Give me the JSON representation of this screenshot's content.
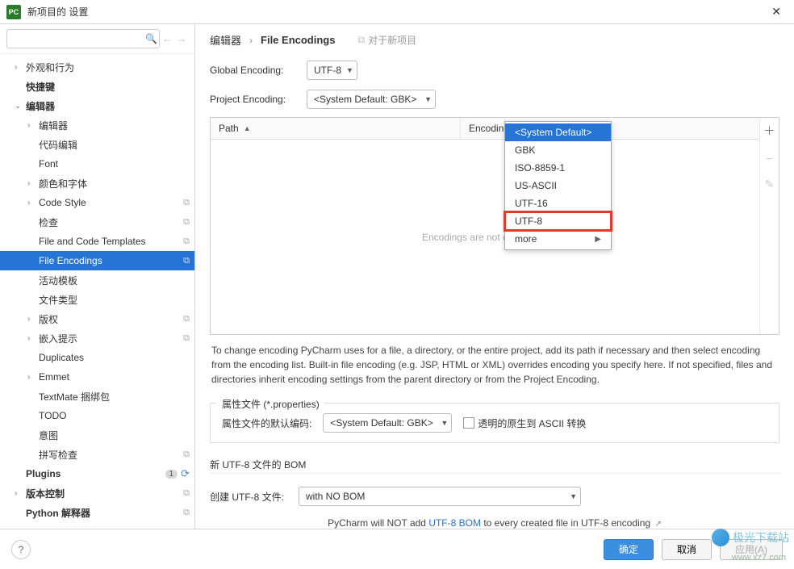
{
  "window": {
    "title": "新项目的 设置",
    "app_icon_text": "PC"
  },
  "search": {
    "placeholder": ""
  },
  "sidebar": {
    "items": [
      {
        "label": "外观和行为",
        "level": 1,
        "chev": "›",
        "bold": false
      },
      {
        "label": "快捷键",
        "level": 1,
        "chev": "",
        "bold": true
      },
      {
        "label": "编辑器",
        "level": 1,
        "chev": "⌄",
        "bold": true
      },
      {
        "label": "编辑器",
        "level": 2,
        "chev": "›"
      },
      {
        "label": "代码编辑",
        "level": 2,
        "chev": ""
      },
      {
        "label": "Font",
        "level": 2,
        "chev": ""
      },
      {
        "label": "颜色和字体",
        "level": 2,
        "chev": "›"
      },
      {
        "label": "Code Style",
        "level": 2,
        "chev": "›",
        "ext": true
      },
      {
        "label": "检查",
        "level": 2,
        "chev": "",
        "ext": true
      },
      {
        "label": "File and Code Templates",
        "level": 2,
        "chev": "",
        "ext": true
      },
      {
        "label": "File Encodings",
        "level": 2,
        "chev": "",
        "ext": true,
        "selected": true
      },
      {
        "label": "活动模板",
        "level": 2,
        "chev": ""
      },
      {
        "label": "文件类型",
        "level": 2,
        "chev": ""
      },
      {
        "label": "版权",
        "level": 2,
        "chev": "›",
        "ext": true
      },
      {
        "label": "嵌入提示",
        "level": 2,
        "chev": "›",
        "ext": true
      },
      {
        "label": "Duplicates",
        "level": 2,
        "chev": ""
      },
      {
        "label": "Emmet",
        "level": 2,
        "chev": "›"
      },
      {
        "label": "TextMate 捆绑包",
        "level": 2,
        "chev": ""
      },
      {
        "label": "TODO",
        "level": 2,
        "chev": ""
      },
      {
        "label": "意图",
        "level": 2,
        "chev": ""
      },
      {
        "label": "拼写检查",
        "level": 2,
        "chev": "",
        "ext": true
      },
      {
        "label": "Plugins",
        "level": 1,
        "chev": "",
        "bold": true,
        "badge": "1",
        "globe": true
      },
      {
        "label": "版本控制",
        "level": 1,
        "chev": "›",
        "bold": true,
        "ext": true
      },
      {
        "label": "Python 解释器",
        "level": 1,
        "chev": "",
        "bold": true,
        "ext": true
      }
    ]
  },
  "breadcrumb": {
    "root": "编辑器",
    "current": "File Encodings",
    "meta": "对于新项目"
  },
  "globalEncoding": {
    "label": "Global Encoding:",
    "value": "UTF-8"
  },
  "projectEncoding": {
    "label": "Project Encoding:",
    "value": "<System Default: GBK>"
  },
  "dropdown": {
    "options": [
      {
        "label": "<System Default>",
        "selected": true
      },
      {
        "label": "GBK"
      },
      {
        "label": "ISO-8859-1"
      },
      {
        "label": "US-ASCII"
      },
      {
        "label": "UTF-16"
      },
      {
        "label": "UTF-8",
        "boxed": true
      },
      {
        "label": "more",
        "more": true
      }
    ]
  },
  "table": {
    "cols": {
      "path": "Path",
      "encoding": "Encoding"
    },
    "empty": "Encodings are not configured"
  },
  "help": "To change encoding PyCharm uses for a file, a directory, or the entire project, add its path if necessary and then select encoding from the encoding list. Built-in file encoding (e.g. JSP, HTML or XML) overrides encoding you specify here. If not specified, files and directories inherit encoding settings from the parent directory or from the Project Encoding.",
  "propsSection": {
    "legend": "属性文件 (*.properties)",
    "defaultLabel": "属性文件的默认编码:",
    "defaultValue": "<System Default: GBK>",
    "checkboxLabel": "透明的原生到 ASCII 转换"
  },
  "bomSection": {
    "title": "新 UTF-8 文件的 BOM",
    "createLabel": "创建 UTF-8 文件:",
    "createValue": "with NO BOM",
    "note_pre": "PyCharm will NOT add ",
    "note_link": "UTF-8 BOM",
    "note_post": " to every created file in UTF-8 encoding"
  },
  "buttons": {
    "ok": "确定",
    "cancel": "取消",
    "apply": "应用(A)"
  },
  "watermark": {
    "text": "极光下载站",
    "url": "www.xz7.com"
  }
}
